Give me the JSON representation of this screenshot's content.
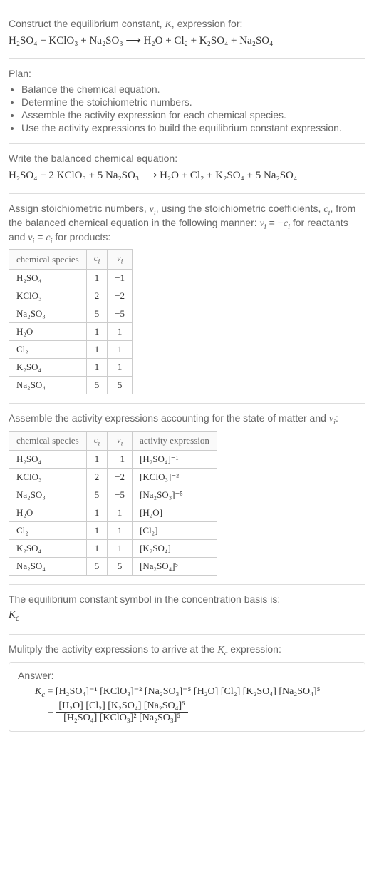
{
  "header": {
    "title": "Construct the equilibrium constant, K, expression for:",
    "equation": "H₂SO₄ + KClO₃ + Na₂SO₃ ⟶ H₂O + Cl₂ + K₂SO₄ + Na₂SO₄"
  },
  "plan": {
    "title": "Plan:",
    "items": [
      "Balance the chemical equation.",
      "Determine the stoichiometric numbers.",
      "Assemble the activity expression for each chemical species.",
      "Use the activity expressions to build the equilibrium constant expression."
    ]
  },
  "balanced": {
    "title": "Write the balanced chemical equation:",
    "equation": "H₂SO₄ + 2 KClO₃ + 5 Na₂SO₃ ⟶ H₂O + Cl₂ + K₂SO₄ + 5 Na₂SO₄"
  },
  "stoich": {
    "blurb": "Assign stoichiometric numbers, νᵢ, using the stoichiometric coefficients, cᵢ, from the balanced chemical equation in the following manner: νᵢ = −cᵢ for reactants and νᵢ = cᵢ for products:",
    "headers": [
      "chemical species",
      "cᵢ",
      "νᵢ"
    ],
    "rows": [
      {
        "species": "H₂SO₄",
        "c": "1",
        "v": "−1"
      },
      {
        "species": "KClO₃",
        "c": "2",
        "v": "−2"
      },
      {
        "species": "Na₂SO₃",
        "c": "5",
        "v": "−5"
      },
      {
        "species": "H₂O",
        "c": "1",
        "v": "1"
      },
      {
        "species": "Cl₂",
        "c": "1",
        "v": "1"
      },
      {
        "species": "K₂SO₄",
        "c": "1",
        "v": "1"
      },
      {
        "species": "Na₂SO₄",
        "c": "5",
        "v": "5"
      }
    ]
  },
  "activity": {
    "blurb": "Assemble the activity expressions accounting for the state of matter and νᵢ:",
    "headers": [
      "chemical species",
      "cᵢ",
      "νᵢ",
      "activity expression"
    ],
    "rows": [
      {
        "species": "H₂SO₄",
        "c": "1",
        "v": "−1",
        "expr": "[H₂SO₄]⁻¹"
      },
      {
        "species": "KClO₃",
        "c": "2",
        "v": "−2",
        "expr": "[KClO₃]⁻²"
      },
      {
        "species": "Na₂SO₃",
        "c": "5",
        "v": "−5",
        "expr": "[Na₂SO₃]⁻⁵"
      },
      {
        "species": "H₂O",
        "c": "1",
        "v": "1",
        "expr": "[H₂O]"
      },
      {
        "species": "Cl₂",
        "c": "1",
        "v": "1",
        "expr": "[Cl₂]"
      },
      {
        "species": "K₂SO₄",
        "c": "1",
        "v": "1",
        "expr": "[K₂SO₄]"
      },
      {
        "species": "Na₂SO₄",
        "c": "5",
        "v": "5",
        "expr": "[Na₂SO₄]⁵"
      }
    ]
  },
  "symbol": {
    "blurb": "The equilibrium constant symbol in the concentration basis is:",
    "value": "K"
  },
  "multiply": {
    "blurb": "Mulitply the activity expressions to arrive at the Kc expression:"
  },
  "answer": {
    "label": "Answer:",
    "line1": "Kc = [H₂SO₄]⁻¹ [KClO₃]⁻² [Na₂SO₃]⁻⁵ [H₂O] [Cl₂] [K₂SO₄] [Na₂SO₄]⁵",
    "frac_num": "[H₂O] [Cl₂] [K₂SO₄] [Na₂SO₄]⁵",
    "frac_den": "[H₂SO₄] [KClO₃]² [Na₂SO₃]⁵"
  },
  "chart_data": {
    "type": "table",
    "tables": [
      {
        "title": "Stoichiometric numbers",
        "columns": [
          "chemical species",
          "c_i",
          "ν_i"
        ],
        "rows": [
          [
            "H2SO4",
            1,
            -1
          ],
          [
            "KClO3",
            2,
            -2
          ],
          [
            "Na2SO3",
            5,
            -5
          ],
          [
            "H2O",
            1,
            1
          ],
          [
            "Cl2",
            1,
            1
          ],
          [
            "K2SO4",
            1,
            1
          ],
          [
            "Na2SO4",
            5,
            5
          ]
        ]
      },
      {
        "title": "Activity expressions",
        "columns": [
          "chemical species",
          "c_i",
          "ν_i",
          "activity expression"
        ],
        "rows": [
          [
            "H2SO4",
            1,
            -1,
            "[H2SO4]^-1"
          ],
          [
            "KClO3",
            2,
            -2,
            "[KClO3]^-2"
          ],
          [
            "Na2SO3",
            5,
            -5,
            "[Na2SO3]^-5"
          ],
          [
            "H2O",
            1,
            1,
            "[H2O]"
          ],
          [
            "Cl2",
            1,
            1,
            "[Cl2]"
          ],
          [
            "K2SO4",
            1,
            1,
            "[K2SO4]"
          ],
          [
            "Na2SO4",
            5,
            5,
            "[Na2SO4]^5"
          ]
        ]
      }
    ]
  }
}
